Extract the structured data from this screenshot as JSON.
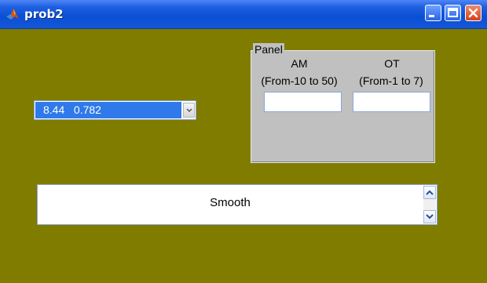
{
  "window": {
    "title": "prob2",
    "icon": "matlab-logo-icon",
    "buttons": [
      "minimize-icon",
      "maximize-icon",
      "close-icon"
    ]
  },
  "popup": {
    "selected_value": "8.44   0.782",
    "arrow_icon": "chevron-down-icon"
  },
  "panel": {
    "title": "Panel",
    "am": {
      "label": "AM",
      "range": "(From-10 to 50)",
      "value": ""
    },
    "ot": {
      "label": "OT",
      "range": "(From-1 to 7)",
      "value": ""
    }
  },
  "listbox": {
    "items": [
      "Smooth"
    ],
    "scroll_up_icon": "chevron-up-icon",
    "scroll_down_icon": "chevron-down-icon"
  },
  "colors": {
    "background": "#7f7c00",
    "titlebar": "#0a4fd4",
    "panel": "#c0c0c0",
    "selection": "#2f79ea"
  }
}
